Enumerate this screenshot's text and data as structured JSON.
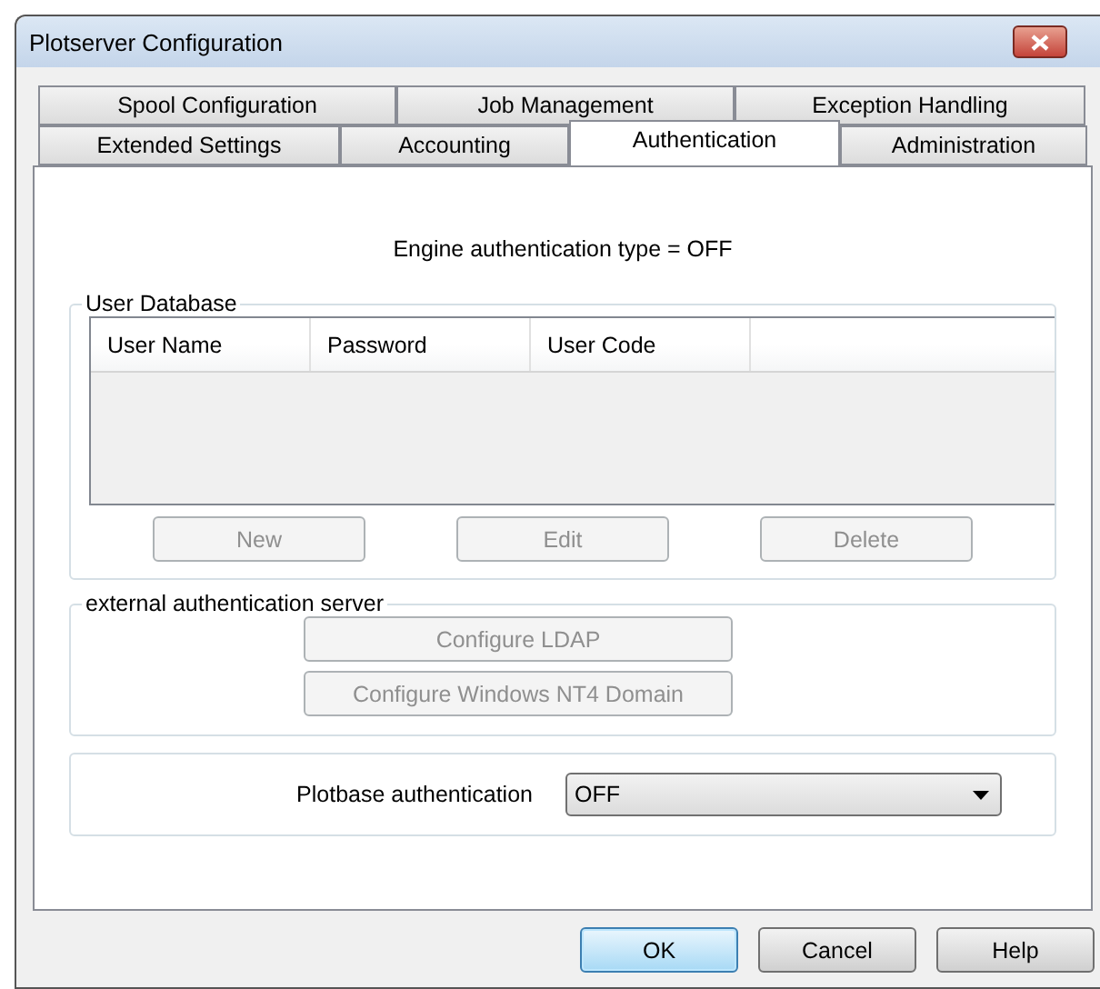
{
  "window": {
    "title": "Plotserver Configuration"
  },
  "tab_rows": [
    [
      {
        "label": "Spool Configuration",
        "selected": false
      },
      {
        "label": "Job Management",
        "selected": false
      },
      {
        "label": "Exception Handling",
        "selected": false
      }
    ],
    [
      {
        "label": "Extended Settings",
        "selected": false
      },
      {
        "label": "Accounting",
        "selected": false
      },
      {
        "label": "Authentication",
        "selected": true
      },
      {
        "label": "Administration",
        "selected": false
      }
    ]
  ],
  "engine_status": "Engine authentication type = OFF",
  "user_database": {
    "title": "User Database",
    "columns": [
      "User Name",
      "Password",
      "User Code"
    ],
    "buttons": [
      {
        "label": "New",
        "disabled": true
      },
      {
        "label": "Edit",
        "disabled": true
      },
      {
        "label": "Delete",
        "disabled": true
      }
    ]
  },
  "external_server": {
    "title": "external authentication server",
    "buttons": [
      {
        "label": "Configure LDAP",
        "disabled": true
      },
      {
        "label": "Configure Windows NT4 Domain",
        "disabled": true
      }
    ]
  },
  "plotbase": {
    "label": "Plotbase authentication",
    "value": "OFF"
  },
  "dialog_buttons": [
    {
      "label": "OK",
      "default": true
    },
    {
      "label": "Cancel",
      "default": false
    },
    {
      "label": "Help",
      "default": false
    }
  ]
}
